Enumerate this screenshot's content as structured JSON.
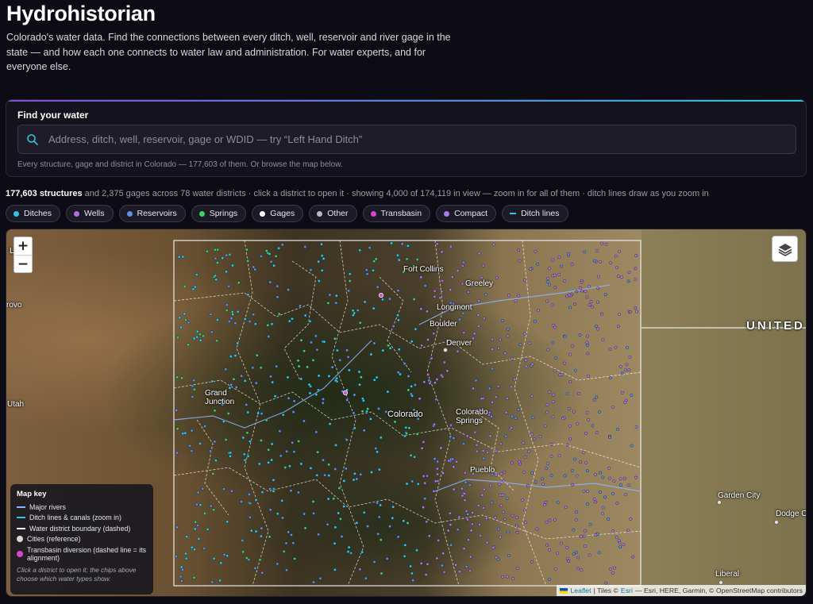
{
  "header": {
    "title": "Hydrohistorian",
    "intro": "Colorado's water data. Find the connections between every ditch, well, reservoir and river gage in the state — and how each one connects to water law and administration. For water experts, and for everyone else."
  },
  "search": {
    "title": "Find your water",
    "placeholder": "Address, ditch, well, reservoir, gage or WDID — try “Left Hand Ditch”",
    "hint": "Every structure, gage and district in Colorado — 177,603 of them. Or browse the map below."
  },
  "stats": {
    "bold": "177,603 structures",
    "rest": " and 2,375 gages across 78 water districts · click a district to open it · showing 4,000 of 174,119 in view — zoom in for all of them · ditch lines draw as you zoom in"
  },
  "chips": [
    {
      "label": "Ditches",
      "color": "#2ec6e6",
      "kind": "dot"
    },
    {
      "label": "Wells",
      "color": "#b56be0",
      "kind": "dot"
    },
    {
      "label": "Reservoirs",
      "color": "#5b8fe8",
      "kind": "dot"
    },
    {
      "label": "Springs",
      "color": "#3fcf6f",
      "kind": "dot"
    },
    {
      "label": "Gages",
      "color": "#ffffff",
      "kind": "dot"
    },
    {
      "label": "Other",
      "color": "#b9b9c4",
      "kind": "dot"
    },
    {
      "label": "Transbasin",
      "color": "#d646d6",
      "kind": "dot"
    },
    {
      "label": "Compact",
      "color": "#a57be8",
      "kind": "dot"
    },
    {
      "label": "Ditch lines",
      "color": "#2ec6e6",
      "kind": "line"
    }
  ],
  "map": {
    "zoom_in": "+",
    "zoom_out": "−",
    "labels": {
      "fort_collins": "Fort Collins",
      "greeley": "Greeley",
      "longmont": "Longmont",
      "boulder": "Boulder",
      "denver": "Denver",
      "grand_junction": "Grand\nJunction",
      "colorado": "Colorado",
      "colorado_springs": "Colorado\nSprings",
      "pueblo": "Pueblo",
      "utah": "Utah",
      "provo": "rovo",
      "united": "UNITED",
      "garden_city": "Garden City",
      "dodge_city": "Dodge C",
      "liberal": "Liberal",
      "edge_l": "L"
    }
  },
  "legend": {
    "title": "Map key",
    "items": [
      {
        "label": "Major rivers",
        "swatch": "line",
        "color": "#8fb4ff"
      },
      {
        "label": "Ditch lines & canals (zoom in)",
        "swatch": "line",
        "color": "#2ec6e6"
      },
      {
        "label": "Water district boundary (dashed)",
        "swatch": "line",
        "color": "#ffffff"
      },
      {
        "label": "Cities (reference)",
        "swatch": "dot",
        "color": "#d9d9d9"
      },
      {
        "label": "Transbasin diversion (dashed line = its alignment)",
        "swatch": "dot",
        "color": "#d646d6"
      }
    ],
    "note": "Click a district to open it; the chips above choose which water types show."
  },
  "attribution": {
    "leaflet": "Leaflet",
    "text": "| Tiles © ",
    "esri": "Esri",
    "rest": " — Esri, HERE, Garmin, © OpenStreetMap contributors"
  }
}
